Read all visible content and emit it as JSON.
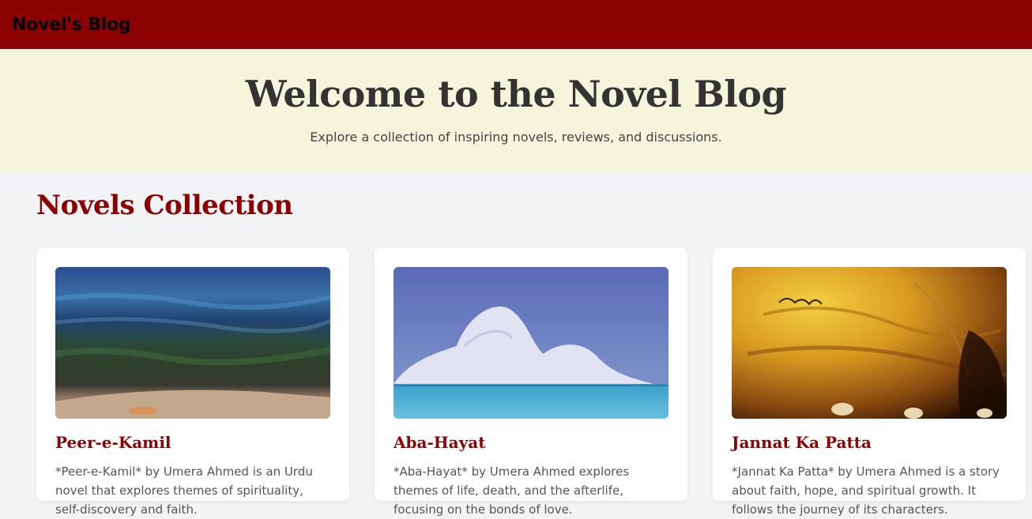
{
  "header": {
    "brand": "Novel's Blog"
  },
  "hero": {
    "title": "Welcome to the Novel Blog",
    "subtitle": "Explore a collection of inspiring novels, reviews, and discussions."
  },
  "collection": {
    "title": "Novels Collection",
    "novels": [
      {
        "title": "Peer-e-Kamil",
        "excerpt": "*Peer-e-Kamil* by Umera Ahmed is an Urdu novel that explores themes of spirituality, self-discovery and faith."
      },
      {
        "title": "Aba-Hayat",
        "excerpt": "*Aba-Hayat* by Umera Ahmed explores themes of life, death, and the afterlife, focusing on the bonds of love."
      },
      {
        "title": "Jannat Ka Patta",
        "excerpt": "*Jannat Ka Patta* by Umera Ahmed is a story about faith, hope, and spiritual growth. It follows the journey of its characters."
      }
    ]
  },
  "icons": {
    "cover1": "abstract-landscape-painting",
    "cover2": "sea-and-clouds-painting",
    "cover3": "golden-calligraphy-cover"
  }
}
